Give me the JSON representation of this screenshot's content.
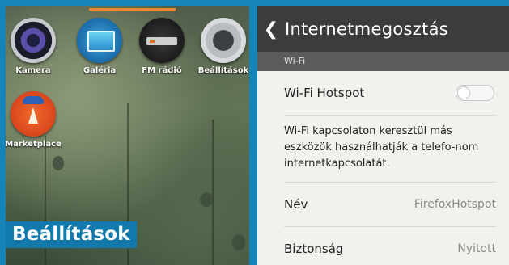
{
  "home": {
    "apps": [
      {
        "label": "Kamera",
        "icon": "camera-icon"
      },
      {
        "label": "Galéria",
        "icon": "gallery-icon"
      },
      {
        "label": "FM rádió",
        "icon": "radio-icon"
      },
      {
        "label": "Beállítások",
        "icon": "settings-icon"
      },
      {
        "label": "Marketplace",
        "icon": "marketplace-icon"
      }
    ],
    "caption": "Beállítások"
  },
  "settings": {
    "back_icon": "chevron-left-icon",
    "title": "Internetmegosztás",
    "section_label": "Wi-Fi",
    "hotspot_label": "Wi-Fi Hotspot",
    "hotspot_enabled": false,
    "description": "Wi-Fi kapcsolaton keresztül más eszközök használhatják a telefo-nom internetkapcsolatát.",
    "name_label": "Név",
    "name_value": "FirefoxHotspot",
    "security_label": "Biztonság",
    "security_value": "Nyitott"
  },
  "colors": {
    "accent_orange": "#e58a2e",
    "caption_blue": "#1279ad",
    "header_dark": "#3c3c3c"
  }
}
